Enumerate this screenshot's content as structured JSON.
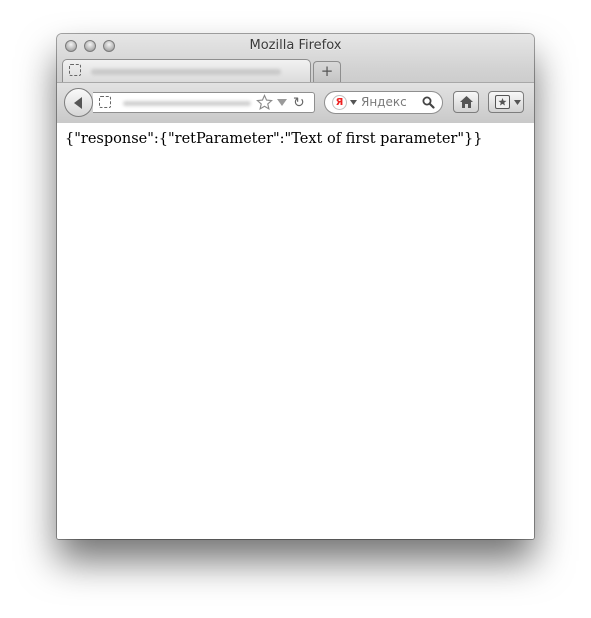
{
  "window": {
    "title": "Mozilla Firefox"
  },
  "tabs": [
    {
      "label": "",
      "active": true
    }
  ],
  "navbar": {
    "url": "",
    "search": {
      "engine": "Яндекс",
      "placeholder": "Яндекс"
    }
  },
  "icons": {
    "new_tab": "+",
    "yandex": "Я",
    "reload": "↻"
  },
  "page": {
    "body_text": "{\"response\":{\"retParameter\":\"Text of first parameter\"}}"
  }
}
